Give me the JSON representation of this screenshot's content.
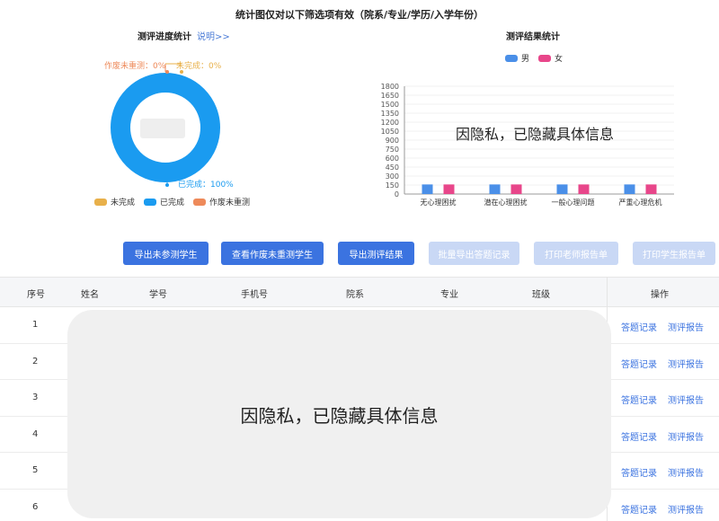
{
  "notice": "统计图仅对以下筛选项有效（院系/专业/学历/入学年份）",
  "progress": {
    "title": "测评进度统计",
    "help_link": "说明>>",
    "labels": {
      "cheat": "作废未重测：0%",
      "unfinished": "未完成：0%",
      "finished": "已完成：100%"
    },
    "legend": [
      "未完成",
      "已完成",
      "作废未重测"
    ],
    "colors": {
      "unfinished": "#e8b04a",
      "finished": "#1a9bf0",
      "cheat": "#ee8a5a"
    }
  },
  "results": {
    "title": "测评结果统计",
    "legend": [
      "男",
      "女"
    ],
    "privacy_note": "因隐私，已隐藏具体信息"
  },
  "chart_data": {
    "type": "bar",
    "categories": [
      "无心理困扰",
      "潜在心理困扰",
      "一般心理问题",
      "严重心理危机"
    ],
    "series": [
      {
        "name": "男",
        "values": [
          160,
          160,
          160,
          160
        ],
        "color": "#4a8fe8"
      },
      {
        "name": "女",
        "values": [
          160,
          160,
          160,
          160
        ],
        "color": "#e8468a"
      }
    ],
    "yticks": [
      0,
      150,
      300,
      450,
      600,
      750,
      900,
      1050,
      1200,
      1350,
      1500,
      1650,
      1800
    ],
    "ylim": [
      0,
      1800
    ]
  },
  "buttons": {
    "export_unassessed": "导出未参测学生",
    "view_cheat": "查看作废未重测学生",
    "export_results": "导出测评结果",
    "batch_export": "批量导出答题记录",
    "print_teacher": "打印老师报告单",
    "print_student": "打印学生报告单"
  },
  "table": {
    "headers": [
      "序号",
      "姓名",
      "学号",
      "手机号",
      "院系",
      "专业",
      "班级",
      "操作"
    ],
    "rows": [
      "1",
      "2",
      "3",
      "4",
      "5",
      "6"
    ],
    "action_record": "答题记录",
    "action_report": "测评报告",
    "privacy_note": "因隐私，已隐藏具体信息"
  }
}
